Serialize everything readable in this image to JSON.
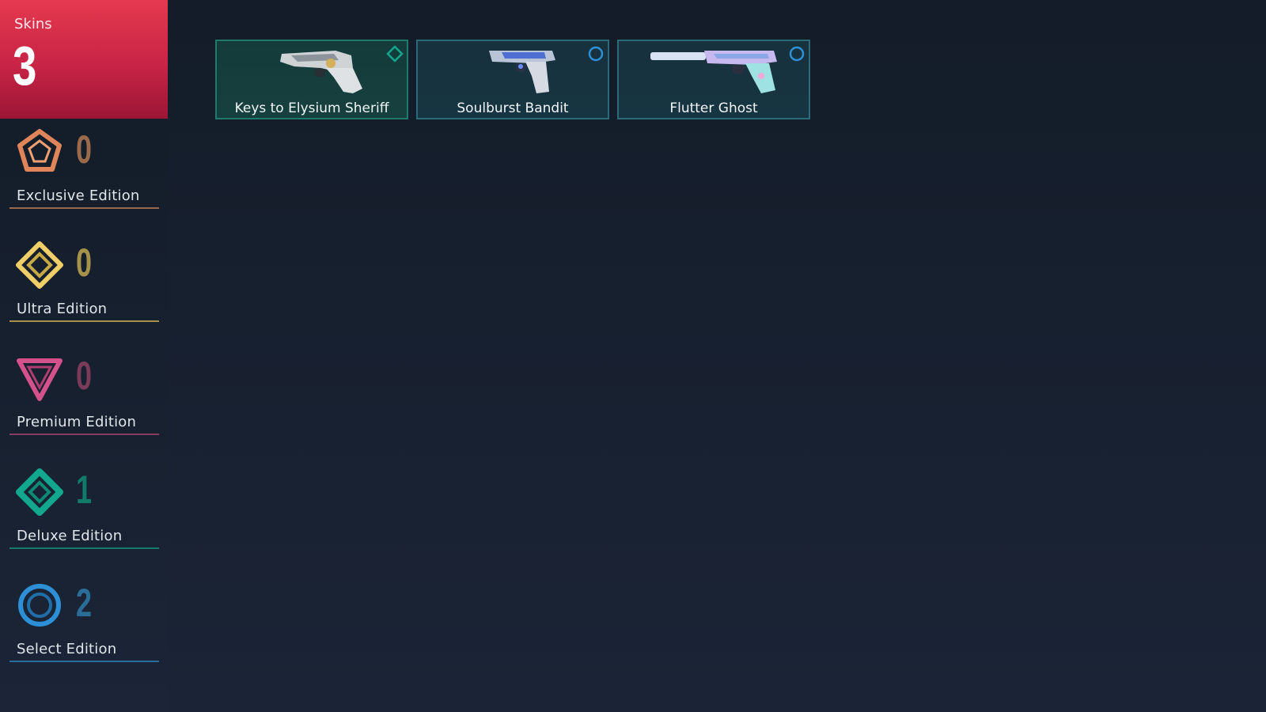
{
  "summary": {
    "label": "Skins",
    "count": "3"
  },
  "tiers": [
    {
      "name": "Exclusive Edition",
      "count": "0",
      "icon": "exclusive-edition-icon",
      "color": "#e0855a",
      "count_color": "#9a6a4a"
    },
    {
      "name": "Ultra Edition",
      "count": "0",
      "icon": "ultra-edition-icon",
      "color": "#f0cf68",
      "count_color": "#a6924a"
    },
    {
      "name": "Premium Edition",
      "count": "0",
      "icon": "premium-edition-icon",
      "color": "#d4518c",
      "count_color": "#7a3a5a"
    },
    {
      "name": "Deluxe Edition",
      "count": "1",
      "icon": "deluxe-edition-icon",
      "color": "#12a88f",
      "count_color": "#127a69"
    },
    {
      "name": "Select Edition",
      "count": "2",
      "icon": "select-edition-icon",
      "color": "#2d8fd6",
      "count_color": "#2a6d98"
    }
  ],
  "skins": [
    {
      "name": "Keys to Elysium Sheriff",
      "tier": "Deluxe Edition",
      "badge_icon": "deluxe-edition-icon",
      "weapon_icon": "sheriff-revolver-icon"
    },
    {
      "name": "Soulburst Bandit",
      "tier": "Select Edition",
      "badge_icon": "select-edition-icon",
      "weapon_icon": "bandit-pistol-icon"
    },
    {
      "name": "Flutter Ghost",
      "tier": "Select Edition",
      "badge_icon": "select-edition-icon",
      "weapon_icon": "ghost-pistol-icon"
    }
  ]
}
